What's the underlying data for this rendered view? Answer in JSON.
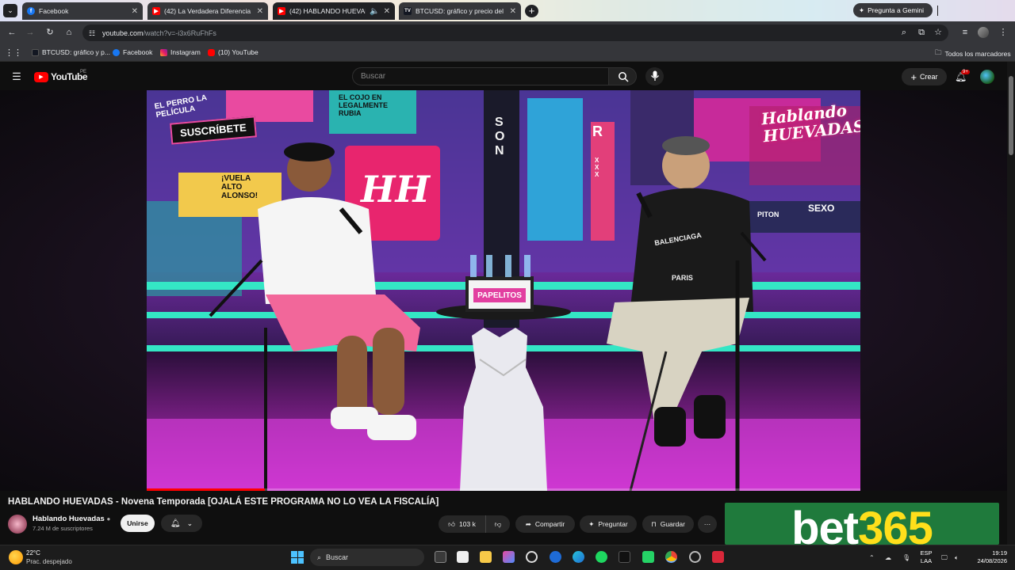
{
  "browser": {
    "tabs": [
      {
        "title": "Facebook",
        "favicon": "facebook-icon",
        "color": "#1877f2"
      },
      {
        "title": "(42) La Verdadera Diferencia E",
        "favicon": "youtube-icon",
        "color": "#ff0000"
      },
      {
        "title": "(42) HABLANDO HUEVADA",
        "favicon": "youtube-icon",
        "color": "#ff0000"
      },
      {
        "title": "BTCUSD: gráfico y precio del Bi",
        "favicon": "tradingview-icon",
        "color": "#ffffff"
      }
    ],
    "gemini_label": "Pregunta a Gemini",
    "url_host": "youtube.com",
    "url_path": "/watch?v=-i3x6RuFhFs",
    "bookmarks": [
      {
        "label": "BTCUSD: gráfico y p...",
        "icon": "tradingview-icon"
      },
      {
        "label": "Facebook",
        "icon": "facebook-icon"
      },
      {
        "label": "Instagram",
        "icon": "instagram-icon"
      },
      {
        "label": "(10) YouTube",
        "icon": "youtube-icon"
      }
    ],
    "all_bookmarks": "Todos los marcadores"
  },
  "youtube": {
    "logo": "YouTube",
    "region": "PE",
    "search_placeholder": "Buscar",
    "create_label": "Crear",
    "notif_count": "9+"
  },
  "video": {
    "title": "HABLANDO HUEVADAS - Novena Temporada [OJALÁ ESTE PROGRAMA NO LO VEA LA FISCALÍA]",
    "progress": 0.165,
    "channel": "Hablando Huevadas",
    "subscribers": "7.24 M de suscriptores",
    "join_label": "Unirse",
    "likes": "103 k",
    "share_label": "Compartir",
    "ask_label": "Preguntar",
    "save_label": "Guardar",
    "scene_texts": {
      "subscribe": "SUSCRÍBETE",
      "vuela": "¡VUELA ALTO ALONSO!",
      "cojo": "EL COJO EN LEGALMENTE RUBIA",
      "perro": "EL PERRO LA PELÍCULA",
      "hh": "HH",
      "vertical": "SON",
      "brand": "Hablando HUEVADAS",
      "papelitos": "PAPELITOS",
      "shirt1": "BALENCIAGA",
      "shirt2": "PARIS",
      "sexo": "SEXO",
      "piton": "PITON",
      "xxx": "XXX",
      "r": "R"
    }
  },
  "ad": {
    "part1": "bet",
    "part2": "365"
  },
  "taskbar": {
    "temperature": "22°C",
    "condition": "Prac. despejado",
    "search_label": "Buscar",
    "lang1": "ESP",
    "lang2": "LAA",
    "time": "19:19",
    "date": "24/08/2026"
  }
}
